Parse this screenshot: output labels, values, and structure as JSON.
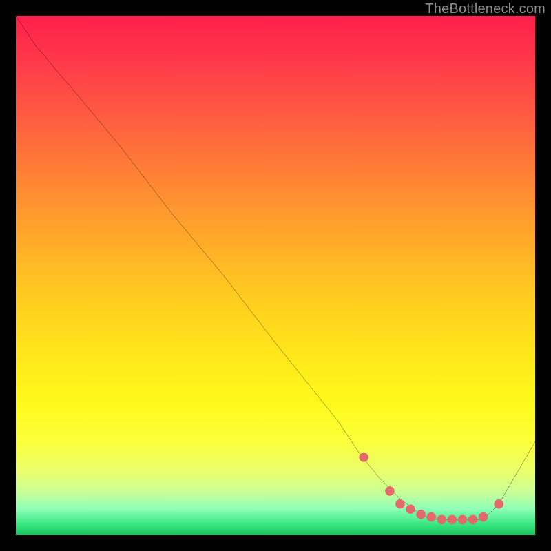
{
  "watermark": "TheBottleneck.com",
  "chart_data": {
    "type": "line",
    "title": "",
    "xlabel": "",
    "ylabel": "",
    "xlim": [
      0,
      100
    ],
    "ylim": [
      0,
      100
    ],
    "grid": false,
    "legend": false,
    "background": "vertical red-to-green gradient",
    "x": [
      0,
      4,
      10,
      20,
      30,
      40,
      50,
      58,
      62,
      66,
      70,
      74,
      78,
      82,
      86,
      90,
      94,
      100
    ],
    "y": [
      100,
      94,
      87,
      75,
      62,
      50,
      37,
      27,
      22,
      16,
      11,
      7,
      4,
      3,
      3,
      3,
      7,
      18
    ],
    "markers": {
      "x": [
        67,
        72,
        74,
        76,
        78,
        80,
        82,
        84,
        86,
        88,
        90,
        93
      ],
      "y": [
        15,
        8.5,
        6,
        5,
        4,
        3.5,
        3,
        3,
        3,
        3,
        3.5,
        6
      ],
      "color": "#e36a6a",
      "size": 7
    },
    "curve_color": "#000000",
    "curve_width": 2
  }
}
